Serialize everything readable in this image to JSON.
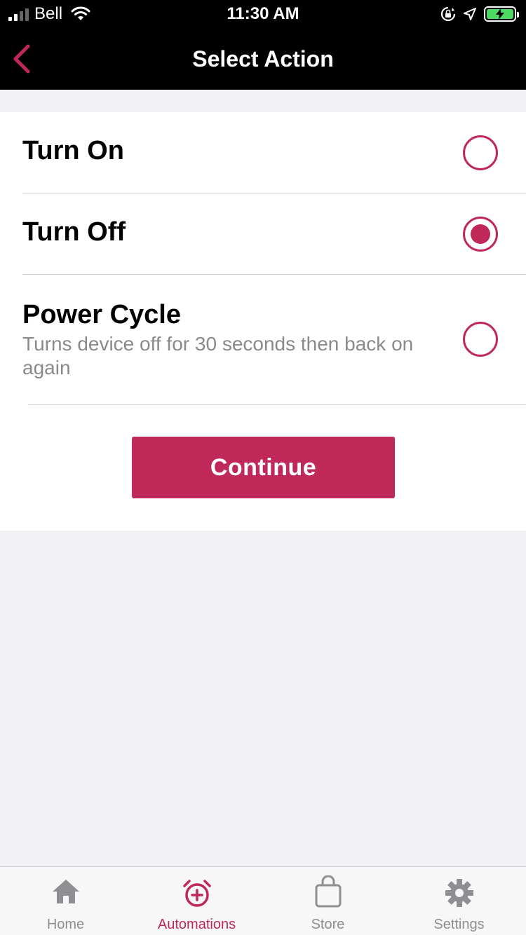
{
  "status_bar": {
    "carrier": "Bell",
    "time": "11:30 AM",
    "icons": [
      "signal-icon",
      "wifi-icon",
      "orientation-lock-icon",
      "location-arrow-icon",
      "battery-charging-icon"
    ]
  },
  "nav": {
    "title": "Select Action",
    "back_icon": "chevron-left-icon"
  },
  "options": [
    {
      "title": "Turn On",
      "description": "",
      "selected": false
    },
    {
      "title": "Turn Off",
      "description": "",
      "selected": true
    },
    {
      "title": "Power Cycle",
      "description": "Turns device off for 30 seconds then back on again",
      "selected": false
    }
  ],
  "continue_label": "Continue",
  "tabs": [
    {
      "label": "Home",
      "icon": "home-icon",
      "active": false
    },
    {
      "label": "Automations",
      "icon": "alarm-clock-plus-icon",
      "active": true
    },
    {
      "label": "Store",
      "icon": "shopping-bag-icon",
      "active": false
    },
    {
      "label": "Settings",
      "icon": "gear-icon",
      "active": false
    }
  ],
  "colors": {
    "accent": "#bf2859",
    "header_bg": "#000000",
    "page_bg": "#f0f0f5",
    "tab_inactive": "#8e8e93"
  }
}
